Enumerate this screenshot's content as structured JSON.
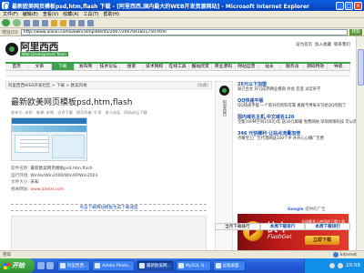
{
  "window": {
    "title": "最新欧美网页模板psd,htm,flash 下载 - [阿里西西,国内最大的WEB开发资源网站] - Microsoft Internet Explorer"
  },
  "menu": [
    "文件(F)",
    "编辑(E)",
    "查看(V)",
    "收藏(A)",
    "工具(T)",
    "帮助(H)"
  ],
  "address": {
    "label": "地址(D)",
    "url": "http://www.alixixi.com/Down/Template/05/2007/2007041811750.html",
    "go_label": "转到"
  },
  "site": {
    "logo_cn": "阿里西西",
    "logo_en": "Web Development Team",
    "header_links": [
      "设为首页",
      "加入收藏",
      "联系我们"
    ],
    "nav": [
      "首页",
      "文章",
      "下载",
      "发布网",
      "技术论坛",
      "搜索",
      "技术网校",
      "在线工具",
      "酷站欣赏",
      "商业源码",
      "网站运营",
      "站长",
      "服务员",
      "源码特效",
      "导航"
    ],
    "active_nav_index": 2
  },
  "breadcrumb": {
    "path": "阿里西西WEB开发社区 > 下载 > 欧美风格",
    "right": "[收藏]"
  },
  "article": {
    "title": "最新欧美网页模板psd,htm,flash",
    "meta": [
      "发布于: 未知",
      "来源: 未知",
      "点评下载",
      "网页作者: 0 条",
      "进入论坛",
      "网站论坛下载"
    ]
  },
  "info": {
    "name_label": "软件名称:",
    "name_value": "最新欧美网页模板psd,htm,flash",
    "env_label": "运行环境:",
    "env_value": "Win9x/Win2000/WinXP/Win2003",
    "size_label": "文件大小:",
    "size_value": "未知",
    "site_label": "相关网站:",
    "site_value": "www.alixixi.com"
  },
  "download_link": "点击下载网站模板生成下载速度",
  "news": [
    {
      "title": "25元以下加盟",
      "desc": "知己古文 开沉成熟网业模商 抄会 恋变 派宏夹学",
      "url": ""
    },
    {
      "title": "QQ快递平版",
      "desc": "QQ快递平版 一个新开的资料可靠 真能不用每天写给QQ的指了",
      "url": ""
    },
    {
      "title": "国内域名主机,中文域名120",
      "desc": "全能100M空间150元/年 送30元邮箱 免费网站 深圳易锋科技 可以改地址简单",
      "url": ""
    },
    {
      "title": "346 元快赚利·让站点流量加倍",
      "desc": "点赚宝上广告代理网送100个IP 开开心心赚广告费",
      "url": ""
    }
  ],
  "google_tag": {
    "brand": "Google",
    "text": "提供的广告"
  },
  "flashget": {
    "name_cn": "快车",
    "name_en": "FlashGet",
    "slogan": "全球最多人使用的下载工具",
    "button": "立即下载"
  },
  "download_tabs": [
    "当月下载排行",
    "本周下载排行",
    "本周下载排行"
  ],
  "statusbar": {
    "text": "完毕",
    "zone": "Internet"
  },
  "taskbar": {
    "start": "开始",
    "tasks": [
      "阿里西西...",
      "Adobe Photo...",
      "最新欧美网...",
      "MySQL Q...",
      "远程桌面..."
    ],
    "active_task_index": 2,
    "clock": "20:58"
  },
  "colors": {
    "accent": "#3ca34a",
    "link": "#1a4ea8",
    "titlebar": "#0a5fe0"
  }
}
